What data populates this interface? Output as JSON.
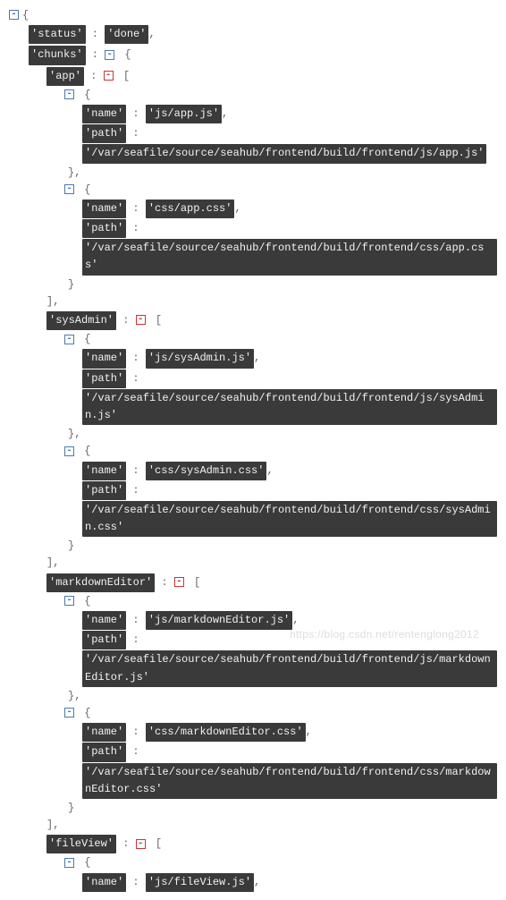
{
  "root": {
    "status_key": "'status'",
    "status_val": "'done'",
    "chunks_key": "'chunks'"
  },
  "app": {
    "key": "'app'",
    "item0_name_k": "'name'",
    "item0_name_v": "'js/app.js'",
    "item0_path_k": "'path'",
    "item0_path_v": "'/var/seafile/source/seahub/frontend/build/frontend/js/app.js'",
    "item1_name_k": "'name'",
    "item1_name_v": "'css/app.css'",
    "item1_path_k": "'path'",
    "item1_path_v": "'/var/seafile/source/seahub/frontend/build/frontend/css/app.css'"
  },
  "sysAdmin": {
    "key": "'sysAdmin'",
    "item0_name_k": "'name'",
    "item0_name_v": "'js/sysAdmin.js'",
    "item0_path_k": "'path'",
    "item0_path_v": "'/var/seafile/source/seahub/frontend/build/frontend/js/sysAdmin.js'",
    "item1_name_k": "'name'",
    "item1_name_v": "'css/sysAdmin.css'",
    "item1_path_k": "'path'",
    "item1_path_v": "'/var/seafile/source/seahub/frontend/build/frontend/css/sysAdmin.css'"
  },
  "markdownEditor": {
    "key": "'markdownEditor'",
    "item0_name_k": "'name'",
    "item0_name_v": "'js/markdownEditor.js'",
    "item0_path_k": "'path'",
    "item0_path_v": "'/var/seafile/source/seahub/frontend/build/frontend/js/markdownEditor.js'",
    "item1_name_k": "'name'",
    "item1_name_v": "'css/markdownEditor.css'",
    "item1_path_k": "'path'",
    "item1_path_v": "'/var/seafile/source/seahub/frontend/build/frontend/css/markdownEditor.css'"
  },
  "fileView": {
    "key": "'fileView'",
    "item0_name_k": "'name'",
    "item0_name_v": "'js/fileView.js'"
  },
  "watermark": "https://blog.csdn.net/rentenglong2012"
}
